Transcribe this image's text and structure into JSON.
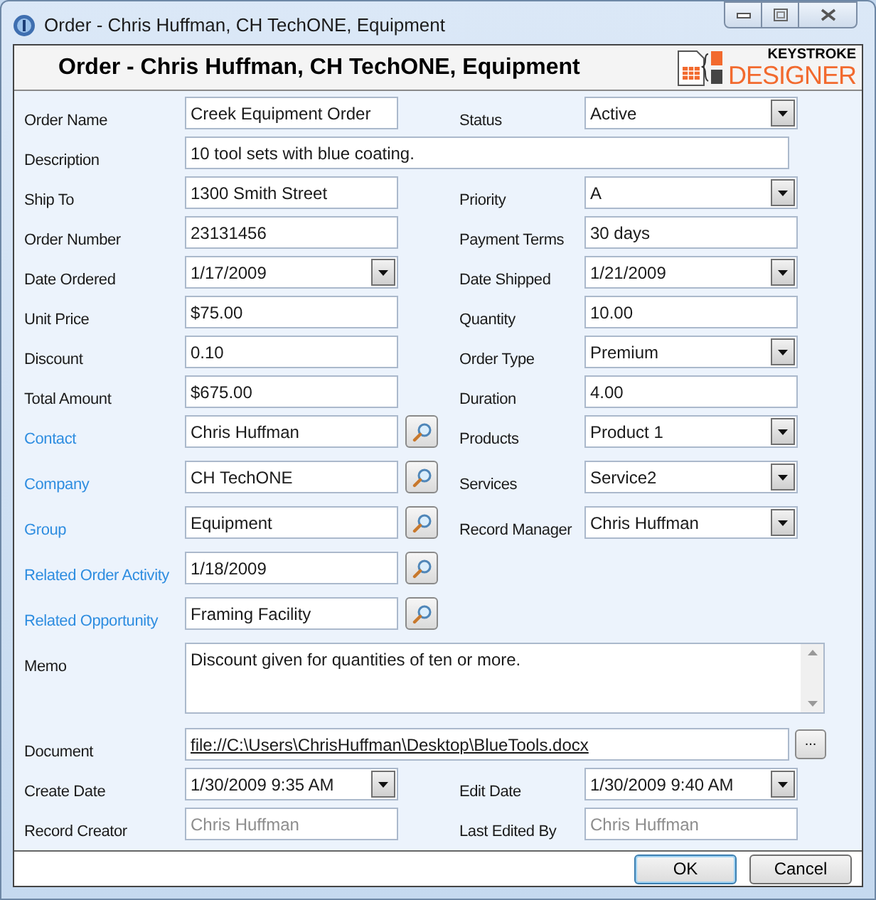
{
  "window": {
    "title": "Order - Chris Huffman, CH TechONE, Equipment"
  },
  "header": {
    "title": "Order - Chris Huffman, CH TechONE, Equipment",
    "logo_top": "KEYSTROKE",
    "logo_bottom": "DESIGNER"
  },
  "rows": [
    {
      "left": {
        "label": "Order Name",
        "kind": "text",
        "value": "Creek Equipment Order"
      },
      "right": {
        "label": "Status",
        "kind": "combo",
        "value": "Active"
      }
    },
    {
      "full": {
        "label": "Description",
        "kind": "wide",
        "value": "10 tool sets with blue coating."
      }
    },
    {
      "left": {
        "label": "Ship To",
        "kind": "text",
        "value": "1300 Smith Street"
      },
      "right": {
        "label": "Priority",
        "kind": "combo",
        "value": "A"
      }
    },
    {
      "left": {
        "label": "Order Number",
        "kind": "text",
        "value": "23131456"
      },
      "right": {
        "label": "Payment Terms",
        "kind": "text",
        "value": "30 days"
      }
    },
    {
      "left": {
        "label": "Date Ordered",
        "kind": "combo",
        "value": "1/17/2009"
      },
      "right": {
        "label": "Date Shipped",
        "kind": "combo",
        "value": "1/21/2009"
      }
    },
    {
      "left": {
        "label": "Unit Price",
        "kind": "text",
        "value": "$75.00"
      },
      "right": {
        "label": "Quantity",
        "kind": "text",
        "value": "10.00"
      }
    },
    {
      "left": {
        "label": "Discount",
        "kind": "text",
        "value": "0.10"
      },
      "right": {
        "label": "Order Type",
        "kind": "combo",
        "value": "Premium"
      }
    },
    {
      "left": {
        "label": "Total Amount",
        "kind": "text",
        "value": "$675.00"
      },
      "right": {
        "label": "Duration",
        "kind": "text",
        "value": "4.00"
      }
    },
    {
      "left": {
        "label": "Contact",
        "kind": "lookup",
        "value": "Chris Huffman"
      },
      "right": {
        "label": "Products",
        "kind": "combo",
        "value": "Product 1"
      }
    },
    {
      "left": {
        "label": "Company",
        "kind": "lookup",
        "value": "CH TechONE"
      },
      "right": {
        "label": "Services",
        "kind": "combo",
        "value": "Service2"
      }
    },
    {
      "left": {
        "label": "Group",
        "kind": "lookup",
        "value": "Equipment"
      },
      "right": {
        "label": "Record Manager",
        "kind": "combo",
        "value": "Chris Huffman"
      }
    },
    {
      "left": {
        "label": "Related Order Activity",
        "kind": "lookup",
        "value": "1/18/2009"
      }
    },
    {
      "left": {
        "label": "Related Opportunity",
        "kind": "lookup",
        "value": "Framing Facility"
      }
    },
    {
      "full": {
        "label": "Memo",
        "kind": "memo",
        "value": "Discount given for quantities of ten or more."
      }
    },
    {
      "full": {
        "label": "Document",
        "kind": "file",
        "value": "file://C:\\Users\\ChrisHuffman\\Desktop\\BlueTools.docx",
        "button": "..."
      }
    },
    {
      "left": {
        "label": "Create Date",
        "kind": "combo",
        "value": "1/30/2009 9:35 AM"
      },
      "right": {
        "label": "Edit Date",
        "kind": "combo",
        "value": "1/30/2009 9:40 AM"
      }
    },
    {
      "left": {
        "label": "Record Creator",
        "kind": "readonly",
        "value": "Chris Huffman"
      },
      "right": {
        "label": "Last Edited By",
        "kind": "readonly",
        "value": "Chris Huffman"
      }
    }
  ],
  "buttons": [
    {
      "label": "OK",
      "default": true
    },
    {
      "label": "Cancel",
      "default": false
    }
  ]
}
